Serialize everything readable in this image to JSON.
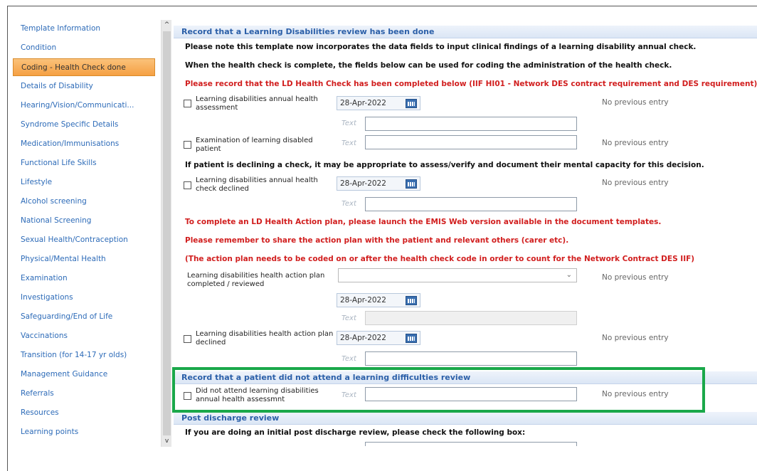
{
  "sidebar": {
    "items": [
      {
        "label": "Template Information",
        "selected": false
      },
      {
        "label": "Condition",
        "selected": false
      },
      {
        "label": "Coding - Health Check done",
        "selected": true
      },
      {
        "label": "Details of Disability",
        "selected": false
      },
      {
        "label": "Hearing/Vision/Communicati...",
        "selected": false
      },
      {
        "label": "Syndrome Specific Details",
        "selected": false
      },
      {
        "label": "Medication/Immunisations",
        "selected": false
      },
      {
        "label": "Functional Life Skills",
        "selected": false
      },
      {
        "label": "Lifestyle",
        "selected": false
      },
      {
        "label": "Alcohol screening",
        "selected": false
      },
      {
        "label": "National Screening",
        "selected": false
      },
      {
        "label": "Sexual Health/Contraception",
        "selected": false
      },
      {
        "label": "Physical/Mental Health",
        "selected": false
      },
      {
        "label": "Examination",
        "selected": false
      },
      {
        "label": "Investigations",
        "selected": false
      },
      {
        "label": "Safeguarding/End of Life",
        "selected": false
      },
      {
        "label": "Vaccinations",
        "selected": false
      },
      {
        "label": "Transition (for 14-17 yr olds)",
        "selected": false
      },
      {
        "label": "Management Guidance",
        "selected": false
      },
      {
        "label": "Referrals",
        "selected": false
      },
      {
        "label": "Resources",
        "selected": false
      },
      {
        "label": "Learning points",
        "selected": false
      }
    ]
  },
  "scroll": {
    "up": "^",
    "down": "v"
  },
  "main": {
    "section1": {
      "header": "Record that a Learning Disabilities review has been done",
      "note1": "Please note this template now incorporates the data fields to input clinical findings of a learning disability annual check.",
      "note2": "When the health check is complete, the fields below can be used for coding the administration of the health check.",
      "note3": "Please record that the LD Health Check has been completed below (IIF HI01 - Network DES contract requirement and DES requirement).",
      "field1_label": "Learning disabilities annual health assessment",
      "field1_date": "28-Apr-2022",
      "field1_text_label": "Text",
      "field1_prev": "No previous entry",
      "field2_label": "Examination of learning disabled patient",
      "field2_text_label": "Text",
      "field2_prev": "No previous entry",
      "note4": "If patient is declining a check, it may be appropriate to assess/verify and document their mental capacity for this decision.",
      "field3_label": "Learning disabilities annual health check declined",
      "field3_date": "28-Apr-2022",
      "field3_text_label": "Text",
      "field3_prev": "No previous entry",
      "note5": "To complete an LD Health Action plan, please launch the EMIS Web version available in the document templates.",
      "note6": "Please remember to share the action plan with the patient and relevant others (carer etc).",
      "note7": "(The action plan needs to be coded on or after the health check code in order to count for the Network Contract DES IIF)",
      "field4_label": "Learning disabilities health action plan completed / reviewed",
      "field4_prev": "No previous entry",
      "field4_date": "28-Apr-2022",
      "field4_text_label": "Text",
      "field5_label": "Learning disabilities health action plan declined",
      "field5_date": "28-Apr-2022",
      "field5_text_label": "Text",
      "field5_prev": "No previous entry"
    },
    "section2": {
      "header": "Record that a patient did not attend a learning difficulties review",
      "field_label": "Did not attend learning disabilities annual health assessmnt",
      "text_label": "Text",
      "prev": "No previous entry"
    },
    "section3": {
      "header": "Post discharge review",
      "note": "If you are doing an initial post discharge review, please check the following box:"
    }
  },
  "colors": {
    "highlight": "#1aa84a",
    "nav_selected": "#f5a043",
    "red_note": "#d11e1e",
    "header_text": "#2b5fa8"
  }
}
